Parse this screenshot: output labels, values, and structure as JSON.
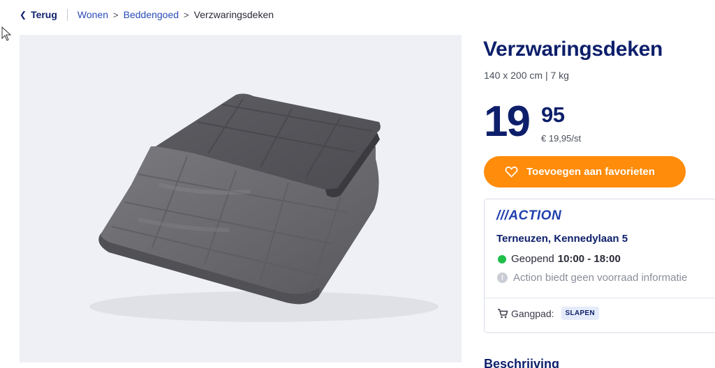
{
  "breadcrumb": {
    "back_label": "Terug",
    "items": [
      "Wonen",
      "Beddengoed"
    ],
    "current": "Verzwaringsdeken"
  },
  "product": {
    "title": "Verzwaringsdeken",
    "subtitle": "140 x 200 cm | 7 kg",
    "price_whole": "19",
    "price_decimals": "95",
    "unit_price": "€ 19,95/st",
    "image_icon": "weighted-blanket-photo"
  },
  "favorite_button": {
    "label": "Toevoegen aan favorieten",
    "icon": "heart-icon"
  },
  "store": {
    "brand": "///ACTION",
    "address": "Terneuzen, Kennedylaan 5",
    "open_label": "Geopend",
    "open_hours": "10:00 - 18:00",
    "stock_info": "Action biedt geen voorraad informatie",
    "aisle_label": "Gangpad:",
    "aisle_value": "SLAPEN"
  },
  "description_heading": "Beschrijving",
  "colors": {
    "brand_navy": "#0d1f6b",
    "action_blue": "#1f3fae",
    "accent_orange": "#ff8c0a",
    "open_green": "#1fbf4a"
  }
}
